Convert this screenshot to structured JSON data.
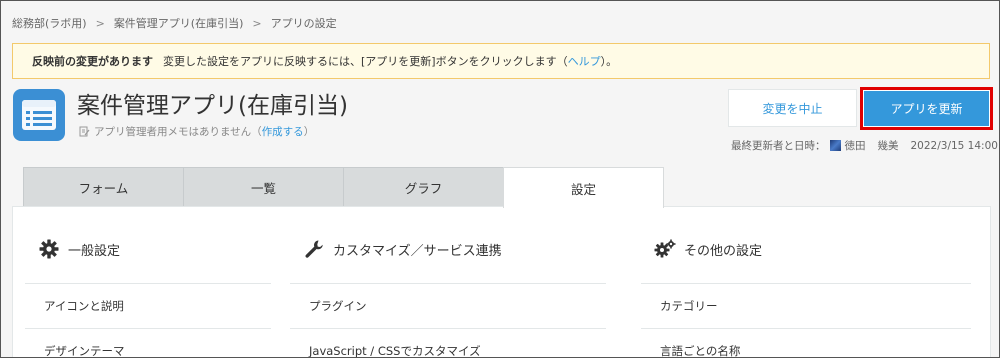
{
  "breadcrumb": [
    "総務部(ラボ用)",
    "案件管理アプリ(在庫引当)",
    "アプリの設定"
  ],
  "breadcrumb_sep": ">",
  "notice": {
    "bold": "反映前の変更があります",
    "text_before": "変更した設定をアプリに反映するには、[アプリを更新]ボタンをクリックします（",
    "help_link": "ヘルプ",
    "text_after": "）。"
  },
  "app": {
    "icon": "list-icon",
    "title": "案件管理アプリ(在庫引当)",
    "memo_text": "アプリ管理者用メモはありません（",
    "memo_link": "作成する",
    "memo_after": "）"
  },
  "buttons": {
    "cancel": "変更を中止",
    "update": "アプリを更新"
  },
  "last_updated": {
    "label": "最終更新者と日時：",
    "user_first": "徳田",
    "user_last": "幾美",
    "datetime": "2022/3/15 14:00"
  },
  "tabs": [
    "フォーム",
    "一覧",
    "グラフ",
    "設定"
  ],
  "active_tab": "設定",
  "columns": [
    {
      "icon": "gear-icon",
      "heading": "一般設定",
      "items": [
        "アイコンと説明",
        "デザインテーマ"
      ]
    },
    {
      "icon": "wrench-icon",
      "heading": "カスタマイズ／サービス連携",
      "items": [
        "プラグイン",
        "JavaScript / CSSでカスタマイズ"
      ]
    },
    {
      "icon": "gears-icon",
      "heading": "その他の設定",
      "items": [
        "カテゴリー",
        "言語ごとの名称"
      ]
    }
  ],
  "colors": {
    "accent": "#3498db",
    "highlight_border": "#e00000",
    "notice_bg": "#fffbe6",
    "app_icon_bg": "#3b8fd4"
  }
}
